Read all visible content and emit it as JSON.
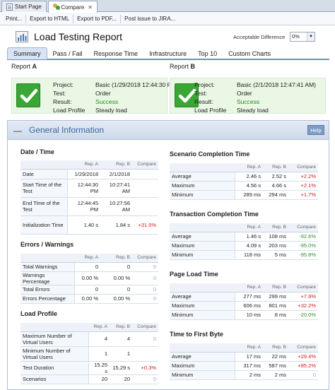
{
  "tabs": [
    {
      "label": "Start Page"
    },
    {
      "label": "Compare"
    }
  ],
  "menu": [
    "Print...",
    "Export to HTML",
    "Export to PDF...",
    "Post issue to JIRA..."
  ],
  "header": {
    "title": "Load Testing Report",
    "acceptable_label": "Acceptable Difference",
    "acceptable_value": "0%"
  },
  "report_tabs": [
    "Summary",
    "Pass / Fail",
    "Response Time",
    "Infrastructure",
    "Top 10",
    "Custom Charts"
  ],
  "report_a": {
    "label": "Report",
    "letter": "A",
    "fields": [
      {
        "k": "Project:",
        "v": "Basic (1/29/2018 12:44:30 PM)"
      },
      {
        "k": "Test:",
        "v": "Order"
      },
      {
        "k": "Result:",
        "v": "Success"
      },
      {
        "k": "Load Profile",
        "v": "Steady load"
      }
    ]
  },
  "report_b": {
    "label": "Report",
    "letter": "B",
    "fields": [
      {
        "k": "Project:",
        "v": "Basic (2/1/2018 12:47:41 AM)"
      },
      {
        "k": "Test:",
        "v": "Order"
      },
      {
        "k": "Result:",
        "v": "Success"
      },
      {
        "k": "Load Profile",
        "v": "Steady load"
      }
    ]
  },
  "general": {
    "title": "General Information",
    "collapse": "—",
    "help": "Help"
  },
  "columns": {
    "a": "Rep. A",
    "b": "Rep. B",
    "cmp": "Compare"
  },
  "datetime": {
    "title": "Date / Time",
    "rows": [
      {
        "n": "Date",
        "a": "1/29/2018",
        "b": "2/1/2018",
        "c": ""
      },
      {
        "n": "Start Time of the Test",
        "a": "12:44:30 PM",
        "b": "10:27:41 AM",
        "c": ""
      },
      {
        "n": "End Time of the Test",
        "a": "12:44:45 PM",
        "b": "10:27:56 AM",
        "c": ""
      },
      {
        "n": "Initialization Time",
        "a": "1.40 s",
        "b": "1.84 s",
        "c": "+31.5%"
      }
    ]
  },
  "errors": {
    "title": "Errors / Warnings",
    "rows": [
      {
        "n": "Total Warnings",
        "a": "0",
        "b": "0",
        "c": "0"
      },
      {
        "n": "Warnings Percentage",
        "a": "0.00 %",
        "b": "0.00 %",
        "c": "0"
      },
      {
        "n": "Total Errors",
        "a": "0",
        "b": "0",
        "c": "0"
      },
      {
        "n": "Errors Percentage",
        "a": "0.00 %",
        "b": "0.00 %",
        "c": "0"
      }
    ]
  },
  "load_profile": {
    "title": "Load Profile",
    "rows": [
      {
        "n": "Maximum Number of Virtual Users",
        "a": "4",
        "b": "4",
        "c": "0"
      },
      {
        "n": "Minimum Number of Virtual Users",
        "a": "1",
        "b": "1",
        "c": ""
      },
      {
        "n": "Test Duration",
        "a": "15.25 s",
        "b": "15.29 s",
        "c": "+0.3%"
      },
      {
        "n": "Scenarios",
        "a": "20",
        "b": "20",
        "c": "0"
      }
    ]
  },
  "scenario": {
    "title": "Scenario Completion Time",
    "rows": [
      {
        "n": "Average",
        "a": "2.46 s",
        "b": "2.52 s",
        "c": "+2.2%"
      },
      {
        "n": "Maximum",
        "a": "4.56 s",
        "b": "4.66 s",
        "c": "+2.1%"
      },
      {
        "n": "Minimum",
        "a": "289 ms",
        "b": "294 ms",
        "c": "+1.7%"
      }
    ]
  },
  "transaction": {
    "title": "Transaction Completion Time",
    "rows": [
      {
        "n": "Average",
        "a": "1.46 s",
        "b": "108 ms",
        "c": "-92.6%"
      },
      {
        "n": "Maximum",
        "a": "4.09 s",
        "b": "203 ms",
        "c": "-95.0%"
      },
      {
        "n": "Minimum",
        "a": "118 ms",
        "b": "5 ms",
        "c": "-95.8%"
      }
    ]
  },
  "page_load": {
    "title": "Page Load Time",
    "rows": [
      {
        "n": "Average",
        "a": "277 ms",
        "b": "299 ms",
        "c": "+7.9%"
      },
      {
        "n": "Maximum",
        "a": "606 ms",
        "b": "801 ms",
        "c": "+32.2%"
      },
      {
        "n": "Minimum",
        "a": "10 ms",
        "b": "8 ms",
        "c": "-20.0%"
      }
    ]
  },
  "first_byte": {
    "title": "Time to First Byte",
    "rows": [
      {
        "n": "Average",
        "a": "17 ms",
        "b": "22 ms",
        "c": "+29.4%"
      },
      {
        "n": "Maximum",
        "a": "317 ms",
        "b": "587 ms",
        "c": "+85.2%"
      },
      {
        "n": "Minimum",
        "a": "2 ms",
        "b": "2 ms",
        "c": "0"
      }
    ]
  }
}
